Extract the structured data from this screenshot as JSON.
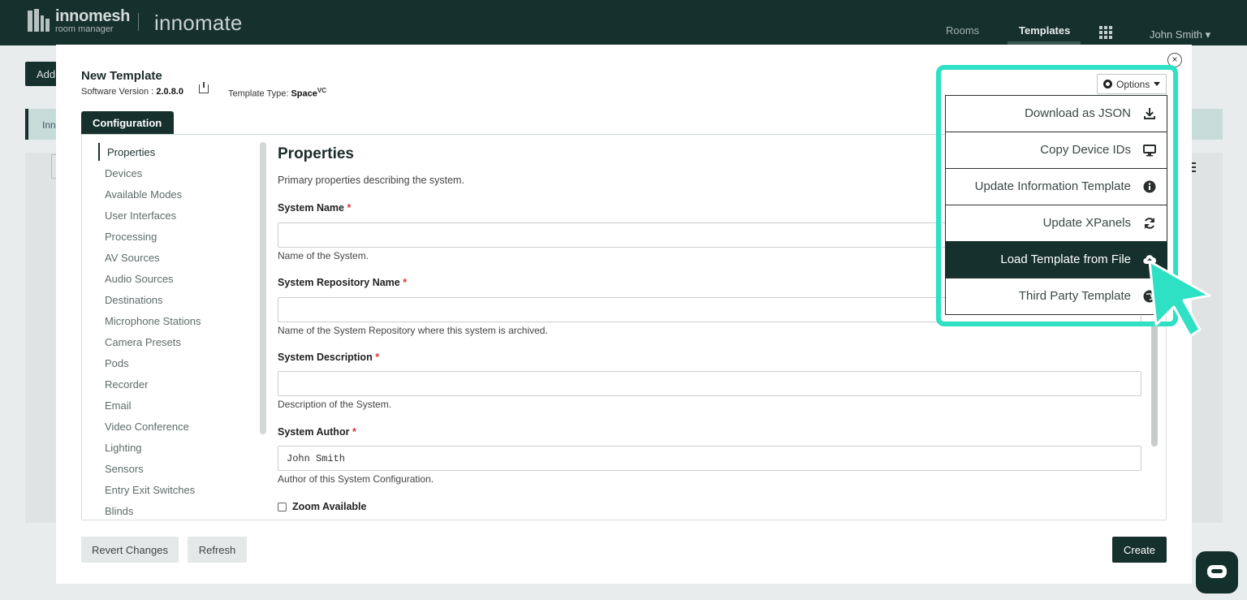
{
  "header": {
    "brand_name": "innomesh",
    "brand_sub": "room manager",
    "app_name": "innomate",
    "nav": [
      {
        "label": "Rooms"
      },
      {
        "label": "Templates"
      }
    ],
    "user": "John Smith ▾"
  },
  "background": {
    "button_label": "Add",
    "banner_text": "Inn"
  },
  "modal": {
    "title": "New Template",
    "software_version_label": "Software Version :",
    "software_version": "2.0.8.0",
    "template_type_label": "Template Type:",
    "template_type": "Space",
    "template_type_sup": "VC",
    "tab": "Configuration",
    "close_glyph": "×"
  },
  "sidebar": {
    "items": [
      {
        "label": "Properties"
      },
      {
        "label": "Devices"
      },
      {
        "label": "Available Modes"
      },
      {
        "label": "User Interfaces"
      },
      {
        "label": "Processing"
      },
      {
        "label": "AV Sources"
      },
      {
        "label": "Audio Sources"
      },
      {
        "label": "Destinations"
      },
      {
        "label": "Microphone Stations"
      },
      {
        "label": "Camera Presets"
      },
      {
        "label": "Pods"
      },
      {
        "label": "Recorder"
      },
      {
        "label": "Email"
      },
      {
        "label": "Video Conference"
      },
      {
        "label": "Lighting"
      },
      {
        "label": "Sensors"
      },
      {
        "label": "Entry Exit Switches"
      },
      {
        "label": "Blinds"
      }
    ]
  },
  "form": {
    "title": "Properties",
    "description": "Primary properties describing the system.",
    "fields": [
      {
        "label": "System Name",
        "value": "",
        "help": "Name of the System."
      },
      {
        "label": "System Repository Name",
        "value": "",
        "help": "Name of the System Repository where this system is archived."
      },
      {
        "label": "System Description",
        "value": "",
        "help": "Description of the System."
      },
      {
        "label": "System Author",
        "value": "John Smith",
        "help": "Author of this System Configuration."
      }
    ],
    "required_mark": "*",
    "checkbox_label": "Zoom Available"
  },
  "footer": {
    "revert": "Revert Changes",
    "refresh": "Refresh",
    "create": "Create"
  },
  "options": {
    "button_label": "Options",
    "items": [
      {
        "label": "Download as JSON",
        "icon": "download-icon"
      },
      {
        "label": "Copy Device IDs",
        "icon": "monitor-icon"
      },
      {
        "label": "Update Information Template",
        "icon": "info-icon"
      },
      {
        "label": "Update XPanels",
        "icon": "refresh-icon"
      },
      {
        "label": "Load Template from File",
        "icon": "cloud-upload-icon",
        "active": true
      },
      {
        "label": "Third Party Template",
        "icon": "globe-icon"
      }
    ]
  },
  "colors": {
    "primary": "#16302d",
    "highlight": "#2ee0c4",
    "required": "#dd3333"
  }
}
